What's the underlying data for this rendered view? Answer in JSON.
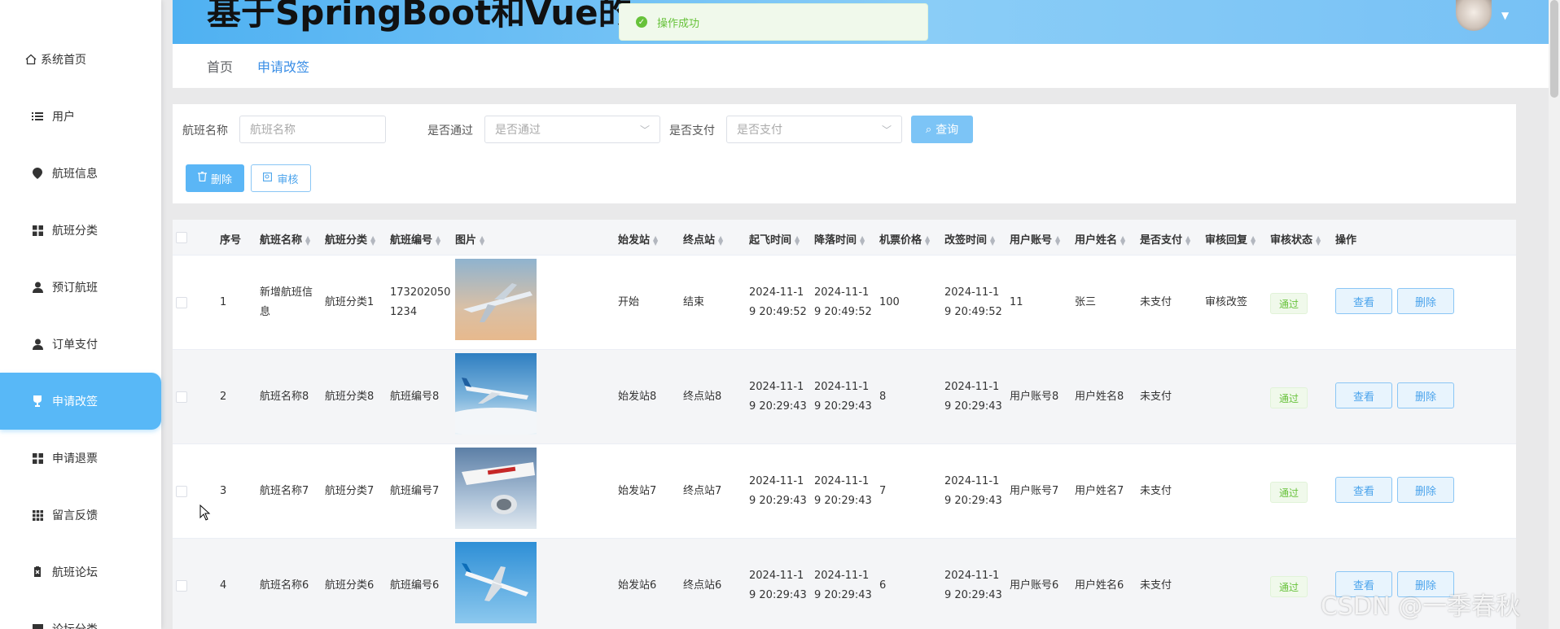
{
  "header": {
    "title": "基于SpringBoot和Vue的机票预订系统的设计与实现",
    "toast": "操作成功",
    "colors": {
      "header_start": "#4fb1f2",
      "header_end": "#8acdf7",
      "accent": "#58b8f7",
      "success": "#67c23a"
    }
  },
  "sidebar": {
    "items": [
      {
        "label": "系统首页",
        "icon": "home-icon"
      },
      {
        "label": "用户",
        "icon": "list-icon"
      },
      {
        "label": "航班信息",
        "icon": "location-pin-icon"
      },
      {
        "label": "航班分类",
        "icon": "grid-icon"
      },
      {
        "label": "预订航班",
        "icon": "person-icon"
      },
      {
        "label": "订单支付",
        "icon": "person-icon"
      },
      {
        "label": "申请改签",
        "icon": "trophy-icon",
        "active": true
      },
      {
        "label": "申请退票",
        "icon": "grid-icon"
      },
      {
        "label": "留言反馈",
        "icon": "apps-icon"
      },
      {
        "label": "航班论坛",
        "icon": "document-icon"
      },
      {
        "label": "论坛分类",
        "icon": "grid-icon"
      }
    ]
  },
  "breadcrumb": {
    "home": "首页",
    "current": "申请改签"
  },
  "search": {
    "flight_name_label": "航班名称",
    "flight_name_placeholder": "航班名称",
    "approved_label": "是否通过",
    "approved_placeholder": "是否通过",
    "paid_label": "是否支付",
    "paid_placeholder": "是否支付",
    "query_button": "查询"
  },
  "actions": {
    "delete_button": "删除",
    "audit_button": "审核"
  },
  "table": {
    "headers": [
      "序号",
      "航班名称",
      "航班分类",
      "航班编号",
      "图片",
      "始发站",
      "终点站",
      "起飞时间",
      "降落时间",
      "机票价格",
      "改签时间",
      "用户账号",
      "用户姓名",
      "是否支付",
      "审核回复",
      "审核状态",
      "操作"
    ],
    "rows": [
      {
        "no": "1",
        "name": "新增航班信息",
        "category": "航班分类1",
        "code": "1732020501234",
        "from": "开始",
        "to": "结束",
        "depart": "2024-11-19 20:49:52",
        "land": "2024-11-19 20:49:52",
        "price": "100",
        "change_time": "2024-11-19 20:49:52",
        "account": "11",
        "user_name": "张三",
        "paid": "未支付",
        "reply": "审核改签",
        "status": "通过",
        "view": "查看",
        "del": "删除"
      },
      {
        "no": "2",
        "name": "航班名称8",
        "category": "航班分类8",
        "code": "航班编号8",
        "from": "始发站8",
        "to": "终点站8",
        "depart": "2024-11-19 20:29:43",
        "land": "2024-11-19 20:29:43",
        "price": "8",
        "change_time": "2024-11-19 20:29:43",
        "account": "用户账号8",
        "user_name": "用户姓名8",
        "paid": "未支付",
        "reply": "",
        "status": "通过",
        "view": "查看",
        "del": "删除"
      },
      {
        "no": "3",
        "name": "航班名称7",
        "category": "航班分类7",
        "code": "航班编号7",
        "from": "始发站7",
        "to": "终点站7",
        "depart": "2024-11-19 20:29:43",
        "land": "2024-11-19 20:29:43",
        "price": "7",
        "change_time": "2024-11-19 20:29:43",
        "account": "用户账号7",
        "user_name": "用户姓名7",
        "paid": "未支付",
        "reply": "",
        "status": "通过",
        "view": "查看",
        "del": "删除"
      },
      {
        "no": "4",
        "name": "航班名称6",
        "category": "航班分类6",
        "code": "航班编号6",
        "from": "始发站6",
        "to": "终点站6",
        "depart": "2024-11-19 20:29:43",
        "land": "2024-11-19 20:29:43",
        "price": "6",
        "change_time": "2024-11-19 20:29:43",
        "account": "用户账号6",
        "user_name": "用户姓名6",
        "paid": "未支付",
        "reply": "",
        "status": "通过",
        "view": "查看",
        "del": "删除"
      }
    ]
  },
  "watermark": "CSDN @一季春秋"
}
